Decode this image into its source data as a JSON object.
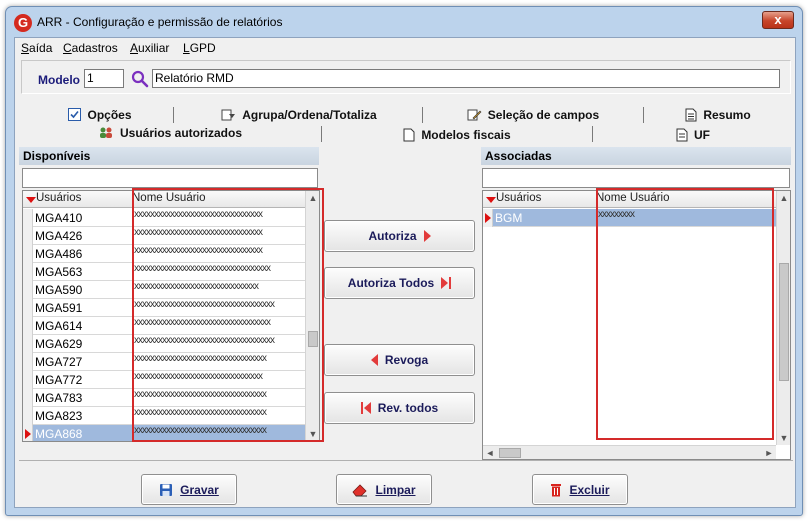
{
  "window": {
    "title": "ARR - Configuração e permissão de relatórios",
    "close_label": "x",
    "app_icon_letter": "G"
  },
  "menu": [
    "Saída",
    "Cadastros",
    "Auxiliar",
    "LGPD"
  ],
  "model": {
    "label": "Modelo",
    "code": "1",
    "description": "Relatório RMD"
  },
  "tabs_row1": [
    "Opções",
    "Agrupa/Ordena/Totaliza",
    "Seleção de campos",
    "Resumo"
  ],
  "tabs_row2": [
    "Usuários autorizados",
    "Modelos fiscais",
    "UF"
  ],
  "available": {
    "title": "Disponíveis",
    "columns": [
      "Usuários",
      "Nome Usuário"
    ],
    "rows": [
      {
        "user": "MGA410",
        "name": "xxxxxxxxxxxxxxxxxxxxxxxxxxxxxxxx"
      },
      {
        "user": "MGA426",
        "name": "xxxxxxxxxxxxxxxxxxxxxxxxxxxxxxxx"
      },
      {
        "user": "MGA486",
        "name": "xxxxxxxxxxxxxxxxxxxxxxxxxxxxxxxx"
      },
      {
        "user": "MGA563",
        "name": "xxxxxxxxxxxxxxxxxxxxxxxxxxxxxxxxxx"
      },
      {
        "user": "MGA590",
        "name": "xxxxxxxxxxxxxxxxxxxxxxxxxxxxxxx"
      },
      {
        "user": "MGA591",
        "name": "xxxxxxxxxxxxxxxxxxxxxxxxxxxxxxxxxxx"
      },
      {
        "user": "MGA614",
        "name": "xxxxxxxxxxxxxxxxxxxxxxxxxxxxxxxxxx"
      },
      {
        "user": "MGA629",
        "name": "xxxxxxxxxxxxxxxxxxxxxxxxxxxxxxxxxxx"
      },
      {
        "user": "MGA727",
        "name": "xxxxxxxxxxxxxxxxxxxxxxxxxxxxxxxxx"
      },
      {
        "user": "MGA772",
        "name": "xxxxxxxxxxxxxxxxxxxxxxxxxxxxxxxx"
      },
      {
        "user": "MGA783",
        "name": "xxxxxxxxxxxxxxxxxxxxxxxxxxxxxxxxx"
      },
      {
        "user": "MGA823",
        "name": "xxxxxxxxxxxxxxxxxxxxxxxxxxxxxxxxx"
      },
      {
        "user": "MGA868",
        "name": "xxxxxxxxxxxxxxxxxxxxxxxxxxxxxxxxx"
      }
    ]
  },
  "associated": {
    "title": "Associadas",
    "columns": [
      "Usuários",
      "Nome Usuário"
    ],
    "rows": [
      {
        "user": "BGM",
        "name": "xxxxxxxxx"
      }
    ]
  },
  "actions": {
    "authorize": "Autoriza",
    "authorize_all": "Autoriza Todos",
    "revoke": "Revoga",
    "revoke_all": "Rev. todos"
  },
  "footer": {
    "save": "Gravar",
    "clear": "Limpar",
    "delete": "Excluir"
  },
  "colors": {
    "accent_red": "#d42a2a",
    "selection": "#9fb9dd",
    "header_bold": "#1b1b7a"
  }
}
